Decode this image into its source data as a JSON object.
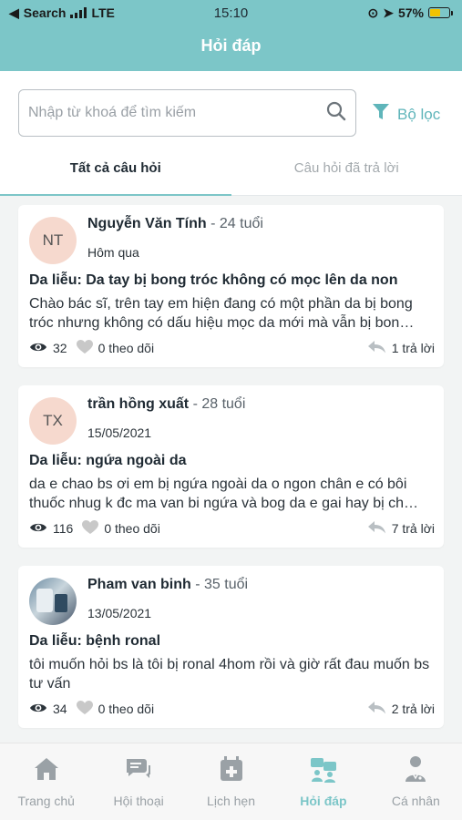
{
  "status_bar": {
    "carrier": "Search",
    "network": "LTE",
    "time": "15:10",
    "battery": "57%"
  },
  "header": {
    "title": "Hỏi đáp"
  },
  "search": {
    "placeholder": "Nhập từ khoá để tìm kiếm",
    "value": ""
  },
  "filter": {
    "label": "Bộ lọc"
  },
  "tabs": [
    {
      "label": "Tất cả câu hỏi",
      "active": true
    },
    {
      "label": "Câu hỏi đã trả lời",
      "active": false
    }
  ],
  "questions": [
    {
      "initials": "NT",
      "name": "Nguyễn Văn Tính",
      "age": "- 24 tuổi",
      "date": "Hôm qua",
      "title": "Da liễu: Da tay bị bong tróc không có mọc lên da non",
      "body": "Chào bác sĩ, trên tay em hiện đang có một phần da bị bong tróc nhưng không có dấu hiệu mọc da mới mà vẫn bị bon…",
      "views": "32",
      "follows": "0 theo dõi",
      "replies": "1 trả lời"
    },
    {
      "initials": "TX",
      "name": "trần hồng xuất",
      "age": "- 28 tuổi",
      "date": "15/05/2021",
      "title": "Da liễu: ngứa ngoài da",
      "body": "da e chao bs ơi em  bị ngứa ngoài da o ngon chân e có bôi thuốc nhug k đc ma van bi ngứa và bog da e gai hay bị ch…",
      "views": "116",
      "follows": "0 theo dõi",
      "replies": "7 trả lời"
    },
    {
      "initials": "",
      "name": "Pham van binh",
      "age": "- 35 tuổi",
      "date": "13/05/2021",
      "title": "Da liễu: bệnh ronal",
      "body": "tôi muốn hỏi bs là tôi bị ronal 4hom rồi và giờ rất đau muốn bs tư vấn",
      "views": "34",
      "follows": "0 theo dõi",
      "replies": "2 trả lời"
    }
  ],
  "tabbar": [
    {
      "label": "Trang chủ",
      "icon": "home-icon",
      "active": false
    },
    {
      "label": "Hội thoại",
      "icon": "chat-icon",
      "active": false
    },
    {
      "label": "Lịch hẹn",
      "icon": "calendar-icon",
      "active": false
    },
    {
      "label": "Hỏi đáp",
      "icon": "qa-icon",
      "active": true
    },
    {
      "label": "Cá nhân",
      "icon": "doctor-icon",
      "active": false
    }
  ],
  "colors": {
    "accent": "#7cc6c8",
    "filter": "#5fb5ba",
    "avatar_bg": "#f6d9ce",
    "inactive": "#9aa1a6"
  }
}
